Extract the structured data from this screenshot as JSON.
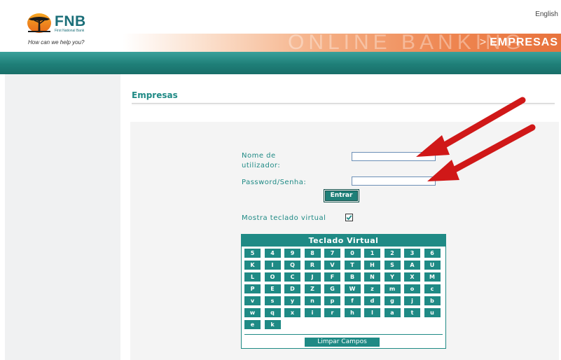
{
  "header": {
    "brand_name": "FNB",
    "brand_subtitle": "First National Bank",
    "tagline": "How can we help you?",
    "language_link": "English",
    "banner_watermark": "ONLINE BANKING",
    "banner_chevron": ">",
    "banner_title": "EMPRESAS"
  },
  "page": {
    "heading": "Empresas"
  },
  "login": {
    "username_label_line1": "Nome de",
    "username_label_line2": "utilizador:",
    "username_value": "",
    "password_label": "Password/Senha:",
    "password_value": "",
    "submit_label": "Entrar",
    "show_keyboard_label": "Mostra teclado virtual",
    "show_keyboard_checked": true
  },
  "keyboard": {
    "title": "Teclado Virtual",
    "rows": [
      [
        "5",
        "4",
        "9",
        "8",
        "7",
        "0",
        "1",
        "2",
        "3",
        "6"
      ],
      [
        "K",
        "I",
        "Q",
        "R",
        "V",
        "T",
        "H",
        "S",
        "A",
        "U"
      ],
      [
        "L",
        "O",
        "C",
        "J",
        "F",
        "B",
        "N",
        "Y",
        "X",
        "M"
      ],
      [
        "P",
        "E",
        "D",
        "Z",
        "G",
        "W",
        "z",
        "m",
        "o",
        "c"
      ],
      [
        "v",
        "s",
        "y",
        "n",
        "p",
        "f",
        "d",
        "g",
        "j",
        "b"
      ],
      [
        "w",
        "q",
        "x",
        "i",
        "r",
        "h",
        "l",
        "a",
        "t",
        "u"
      ],
      [
        "e",
        "k"
      ]
    ],
    "clear_label": "Limpar Campos"
  },
  "colors": {
    "teal": "#1f8a85",
    "orange": "#e8733d",
    "annotation_arrow": "#d01818"
  }
}
